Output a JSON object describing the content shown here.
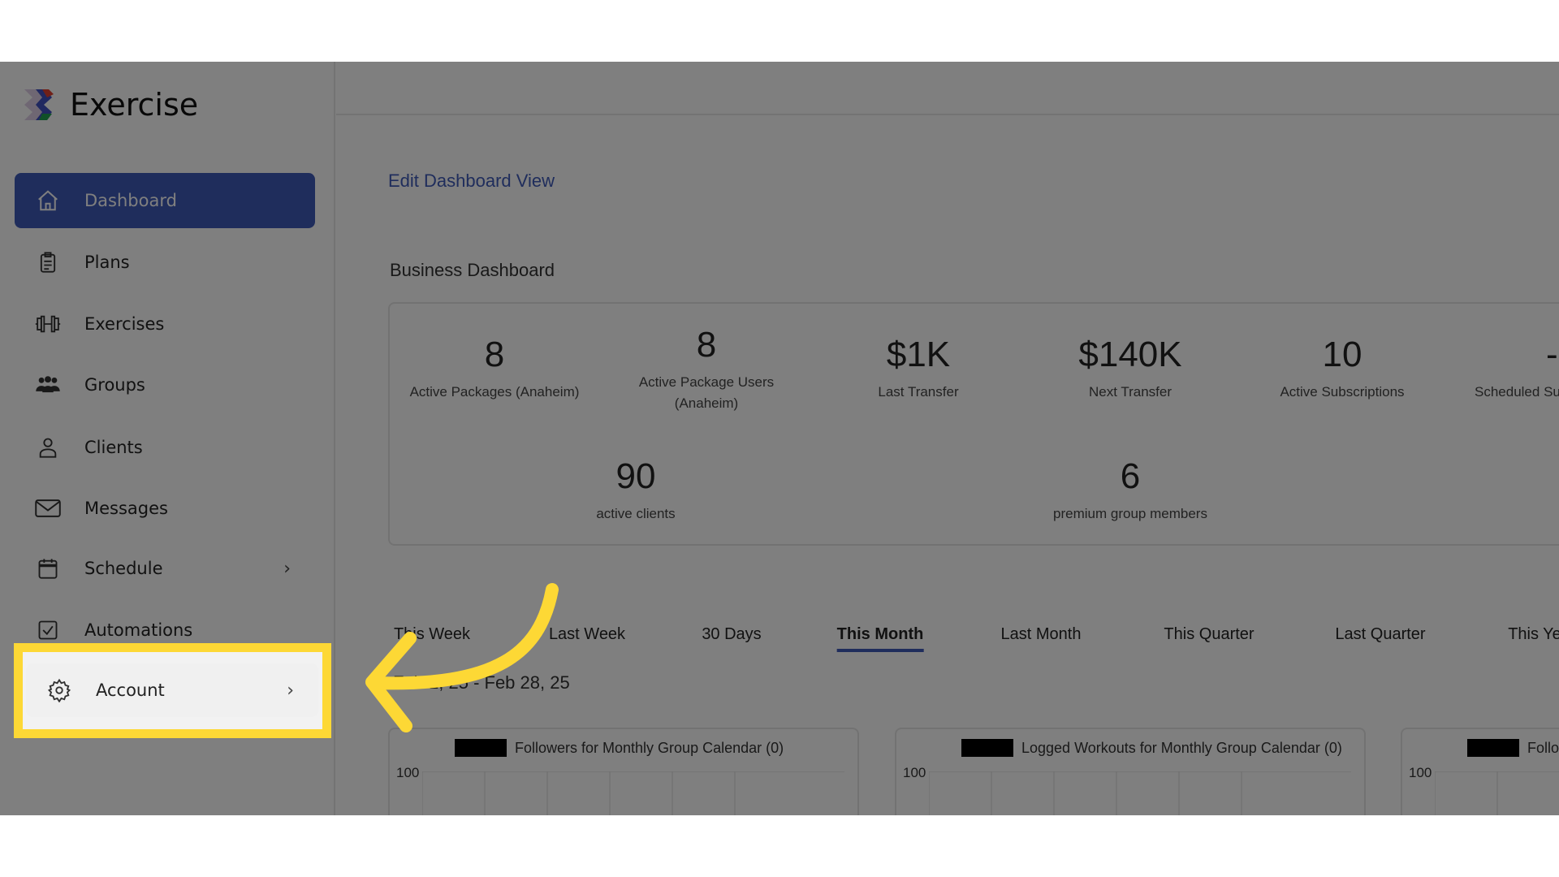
{
  "app": {
    "name": "Exercise"
  },
  "sidebar": {
    "items": [
      {
        "label": "Dashboard",
        "icon": "home-icon",
        "active": true
      },
      {
        "label": "Plans",
        "icon": "clipboard-icon"
      },
      {
        "label": "Exercises",
        "icon": "dumbbell-icon"
      },
      {
        "label": "Groups",
        "icon": "users-icon"
      },
      {
        "label": "Clients",
        "icon": "user-icon"
      },
      {
        "label": "Messages",
        "icon": "mail-icon"
      },
      {
        "label": "Schedule",
        "icon": "calendar-icon",
        "expandable": true
      },
      {
        "label": "Automations",
        "icon": "checkbox-icon"
      },
      {
        "label": "Account",
        "icon": "gear-icon",
        "expandable": true,
        "highlighted": true
      }
    ]
  },
  "main": {
    "edit_link": "Edit Dashboard View",
    "section_title": "Business Dashboard",
    "stats": [
      {
        "value": "8",
        "label": "Active Packages (Anaheim)"
      },
      {
        "value": "8",
        "label": "Active Package Users (Anaheim)"
      },
      {
        "value": "$1K",
        "label": "Last Transfer"
      },
      {
        "value": "$140K",
        "label": "Next Transfer"
      },
      {
        "value": "10",
        "label": "Active Subscriptions"
      },
      {
        "value": "--",
        "label": "Scheduled Su"
      },
      {
        "value": "90",
        "label": "active clients"
      },
      {
        "value": "6",
        "label": "premium group members"
      }
    ],
    "tabs": [
      "This Week",
      "Last Week",
      "30 Days",
      "This Month",
      "Last Month",
      "This Quarter",
      "Last Quarter",
      "This Ye"
    ],
    "active_tab": "This Month",
    "date_range": "Feb 1, 25 - Feb 28, 25",
    "charts": [
      {
        "legend": "Followers for Monthly Group Calendar (0)",
        "ytick": "100"
      },
      {
        "legend": "Logged Workouts for Monthly Group Calendar (0)",
        "ytick": "100"
      },
      {
        "legend": "Followe",
        "ytick": "100"
      }
    ]
  },
  "colors": {
    "accent": "#3f5ab8",
    "highlight": "#fdd835",
    "overlay": "rgba(0,0,0,0.5)"
  }
}
